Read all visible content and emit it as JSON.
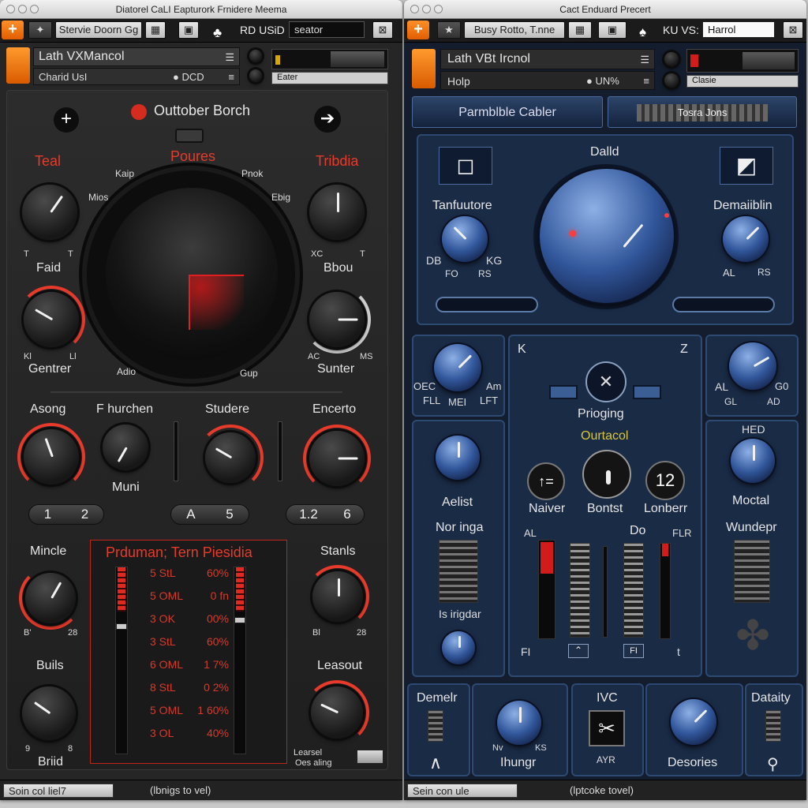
{
  "left": {
    "title": "Diatorel CaLI Eapturork Frnidere Meema",
    "toolbar": {
      "preset": "Stervie Doorn Gg",
      "mode": "RD USiD",
      "search": "seator"
    },
    "header": {
      "name": "Lath VXMancol",
      "sub": "Charid UsI",
      "status": "DCD",
      "info": "Eater"
    },
    "section_title": "Outtober Borch",
    "big_label": "Poures",
    "labels": {
      "teal": "Teal",
      "tribdia": "Tribdia",
      "faid": "Faid",
      "bbou": "Bbou",
      "gentrer": "Gentrer",
      "sunter": "Sunter",
      "asong": "Asong",
      "phurchen": "F hurchen",
      "studere": "Studere",
      "encerto": "Encerto",
      "muni": "Muni",
      "mincle": "Mincle",
      "stanls": "Stanls",
      "buils": "Buils",
      "leasout": "Leasout",
      "briid": "Briid"
    },
    "small": {
      "kaip": "Kaip",
      "pnok": "Pnok",
      "mios": "Mios",
      "ebig": "Ebig",
      "t1": "T",
      "t2": "T",
      "x1": "XC",
      "x2": "T",
      "k1": "Kl",
      "k2": "Ll",
      "ac": "AC",
      "ms": "MS",
      "adio": "Adio",
      "gup": "Gup",
      "b1": "B'",
      "b2": "28",
      "b3": "Bl",
      "b4": "28",
      "n9": "9",
      "n8": "8",
      "learsel": "Learsel",
      "lesaling": "Oes aling"
    },
    "segs": [
      [
        "1",
        "2"
      ],
      [
        "A",
        "5"
      ],
      [
        "1.2",
        "6"
      ]
    ],
    "table": {
      "title": "Prduman; Tern Piesidia",
      "rows": [
        [
          "5 StL",
          "60%"
        ],
        [
          "5 OML",
          "0 fn"
        ],
        [
          "3 OK",
          "00%"
        ],
        [
          "3 StL",
          "60%"
        ],
        [
          "6 OML",
          "1 7%"
        ],
        [
          "8 StL",
          "0 2%"
        ],
        [
          "5 OML",
          "1 60%"
        ],
        [
          "3 OL",
          "40%"
        ]
      ]
    },
    "status": {
      "button": "Soin col liel7",
      "text": "(lbnigs to vel)"
    }
  },
  "right": {
    "title": "Cact Enduard Precert",
    "toolbar": {
      "preset": "Busy Rotto, T.nne",
      "mode": "KU VS:",
      "search": "Harrol"
    },
    "header": {
      "name": "Lath VBt Ircnol",
      "sub": "Holp",
      "status": "UN%",
      "info": "Clasie"
    },
    "tabs": {
      "left": "Parmblble Cabler",
      "right": "Tosra Jons"
    },
    "labels": {
      "dalld": "Dalld",
      "tanfuutore": "Tanfuutore",
      "demaiiblin": "Demaiiblin",
      "prioging": "Prioging",
      "ourtacol": "Ourtacol",
      "aelist": "Aelist",
      "naiver": "Naiver",
      "bontst": "Bontst",
      "lonberr": "Lonberr",
      "mocral": "Moctal",
      "noringa": "Nor inga",
      "wundepr": "Wundepr",
      "isingdar": "Is irigdar",
      "demelr": "Demelr",
      "ivc": "IVC",
      "datalty": "Dataity",
      "hungr": "Ihungr",
      "desories": "Desories"
    },
    "small": {
      "db": "DB",
      "kg": "KG",
      "fo": "FO",
      "rs": "RS",
      "al": "AL",
      "rs2": "RS",
      "k": "K",
      "z": "Z",
      "oec": "OEC",
      "am": "Am",
      "fll": "FLL",
      "mei": "MEI",
      "lft": "LFT",
      "al2": "AL",
      "g0": "G0",
      "gl": "GL",
      "ad": "AD",
      "hed": "HED",
      "al3": "AL",
      "do": "Do",
      "flr": "FLR",
      "fi": "FI",
      "fi2": "FI",
      "t": "t",
      "n": "Nv",
      "ks": "KS",
      "ayr": "AYR",
      "num": "12"
    },
    "status": {
      "button": "Sein con ule",
      "text": "(lptcoke tovel)"
    }
  }
}
